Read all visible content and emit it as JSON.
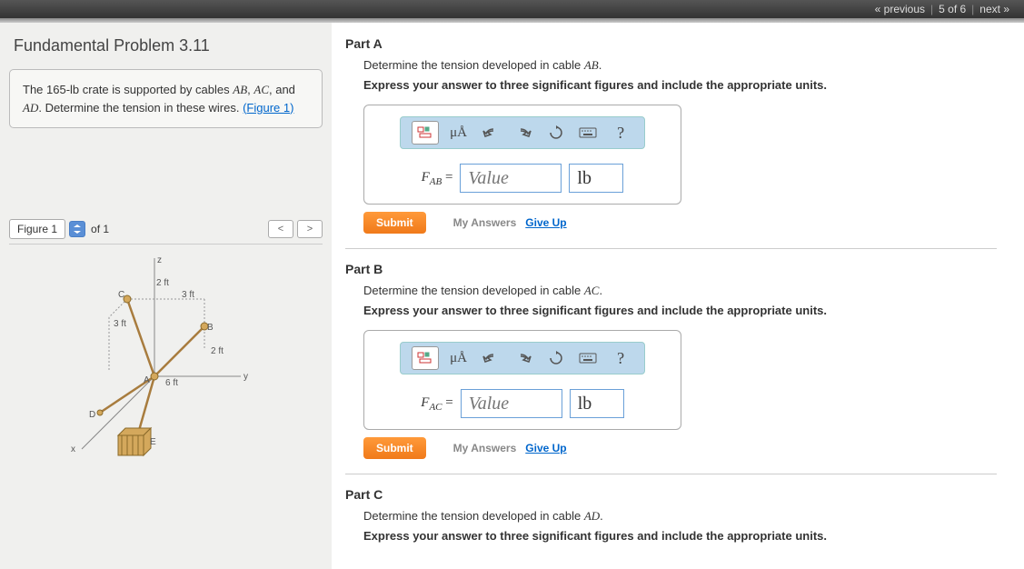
{
  "nav": {
    "prev": "« previous",
    "pos": "5 of 6",
    "next": "next »"
  },
  "problem": {
    "title": "Fundamental Problem 3.11",
    "text_a": "The 165-lb crate is supported by cables ",
    "ab": "AB",
    "comma": ", ",
    "ac": "AC",
    "and": ", and ",
    "ad": "AD",
    "text_b": ". Determine the tension in these wires. ",
    "fig_link": "(Figure 1)"
  },
  "figure": {
    "tab": "Figure 1",
    "of": "of 1",
    "labels": {
      "z": "z",
      "y": "y",
      "x": "x",
      "A": "A",
      "B": "B",
      "C": "C",
      "D": "D",
      "E": "E",
      "d1": "2 ft",
      "d2": "3 ft",
      "d3": "3 ft",
      "d4": "2 ft",
      "d5": "6 ft"
    }
  },
  "partA": {
    "title": "Part A",
    "desc_a": "Determine the tension developed in cable ",
    "cable": "AB",
    "period": ".",
    "instr": "Express your answer to three significant figures and include the appropriate units.",
    "var_main": "F",
    "var_sub": "AB",
    "eq": " =",
    "placeholder": "Value",
    "unit": "lb",
    "toolbar": {
      "special": "μÅ",
      "help": "?"
    }
  },
  "partB": {
    "title": "Part B",
    "desc_a": "Determine the tension developed in cable ",
    "cable": "AC",
    "period": ".",
    "instr": "Express your answer to three significant figures and include the appropriate units.",
    "var_main": "F",
    "var_sub": "AC",
    "eq": " =",
    "placeholder": "Value",
    "unit": "lb",
    "toolbar": {
      "special": "μÅ",
      "help": "?"
    }
  },
  "partC": {
    "title": "Part C",
    "desc_a": "Determine the tension developed in cable ",
    "cable": "AD",
    "period": ".",
    "instr": "Express your answer to three significant figures and include the appropriate units."
  },
  "actions": {
    "submit": "Submit",
    "my_answers": "My Answers",
    "give_up": "Give Up"
  }
}
